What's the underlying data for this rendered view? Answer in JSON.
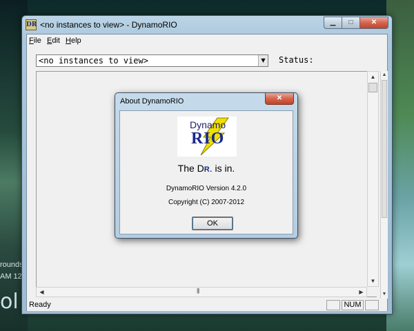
{
  "window": {
    "title": "<no instances to view> - DynamoRIO",
    "icon_text": "DR"
  },
  "menu": {
    "items": [
      {
        "label": "File"
      },
      {
        "label": "Edit"
      },
      {
        "label": "Help"
      }
    ]
  },
  "toolbar": {
    "instances_combo_value": "<no instances to view>",
    "status_label": "Status:"
  },
  "statusbar": {
    "text": "Ready",
    "num": "NUM"
  },
  "about_dialog": {
    "title": "About DynamoRIO",
    "logo_top": "Dynamo",
    "logo_main": "RIO",
    "tagline_pre": "The D",
    "tagline_r": "R",
    "tagline_post": ". is in.",
    "version": "DynamoRIO Version 4.2.0",
    "copyright": "Copyright (C) 2007-2012",
    "ok_label": "OK"
  },
  "desktop": {
    "text_fragment_1": "rounds",
    "text_fragment_2": "AM  12-",
    "text_fragment_3": "ol"
  },
  "colors": {
    "logo_bolt": "#f0e000",
    "logo_text": "#1a2a8a",
    "close_button": "#c2432a"
  }
}
